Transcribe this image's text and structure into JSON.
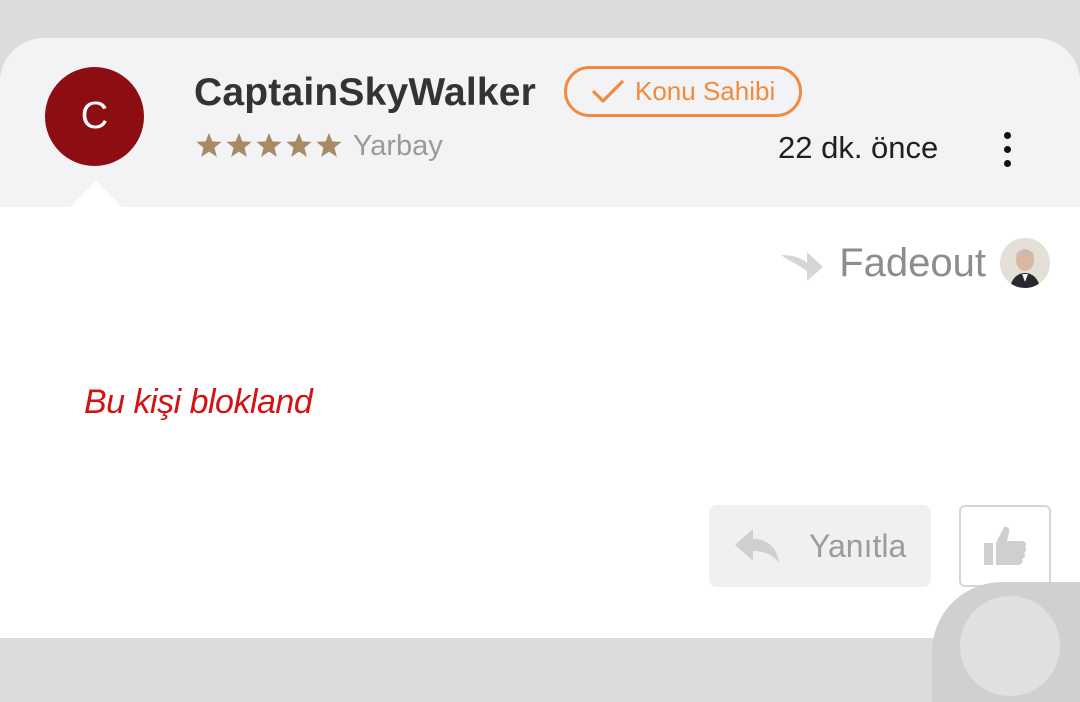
{
  "post": {
    "author": {
      "initial": "C",
      "name": "CaptainSkyWalker",
      "avatar_color": "#8c0e12",
      "badge": "Konu Sahibi",
      "badge_color": "#ef8a3f",
      "stars": 5,
      "star_color": "#a78a66",
      "rank": "Yarbay"
    },
    "time": "22 dk. önce",
    "menu_icon": "more-vertical-icon",
    "reply_to": {
      "name": "Fadeout",
      "arrow_icon": "reply-forward-icon",
      "avatar_icon": "user-photo"
    },
    "blocked_text": "Bu kişi blokland",
    "blocked_color": "#d31212",
    "actions": {
      "reply_label": "Yanıtla",
      "reply_icon": "reply-icon",
      "like_icon": "thumbs-up-icon"
    }
  }
}
